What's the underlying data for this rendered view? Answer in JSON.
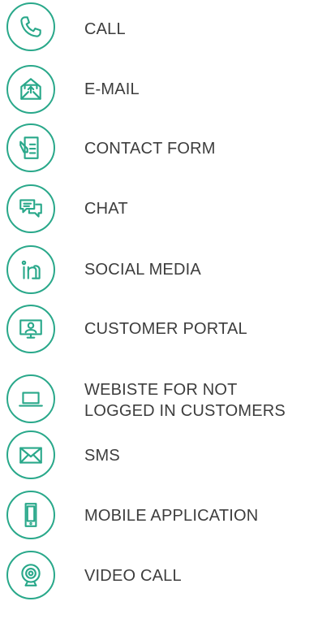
{
  "accent_color": "#29a88a",
  "items": [
    {
      "label": "CALL",
      "icon": "phone-icon"
    },
    {
      "label": "E-MAIL",
      "icon": "email-icon"
    },
    {
      "label": "CONTACT FORM",
      "icon": "contact-form-icon"
    },
    {
      "label": "CHAT",
      "icon": "chat-icon"
    },
    {
      "label": "SOCIAL MEDIA",
      "icon": "linkedin-icon"
    },
    {
      "label": "CUSTOMER PORTAL",
      "icon": "customer-portal-icon"
    },
    {
      "label": "WEBISTE FOR NOT\nLOGGED IN CUSTOMERS",
      "icon": "laptop-icon"
    },
    {
      "label": "SMS",
      "icon": "envelope-icon"
    },
    {
      "label": "MOBILE APPLICATION",
      "icon": "mobile-phone-icon"
    },
    {
      "label": "VIDEO CALL",
      "icon": "webcam-icon"
    }
  ]
}
